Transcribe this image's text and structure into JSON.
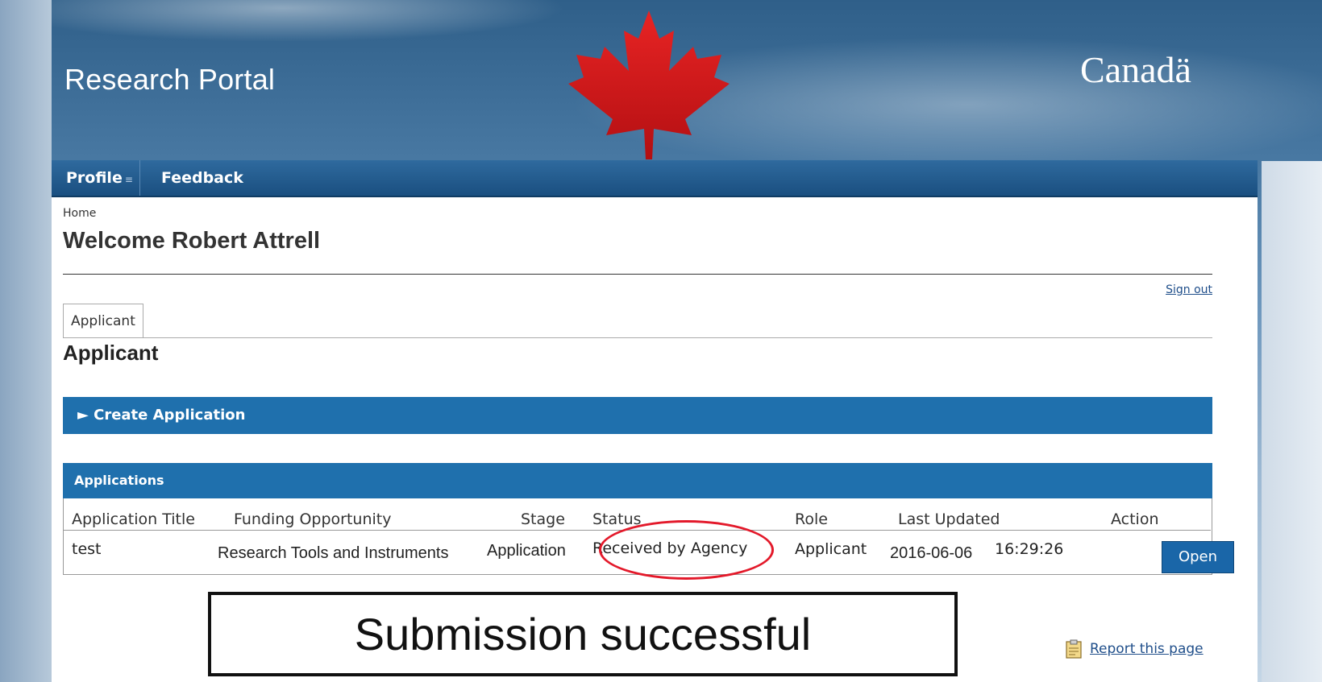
{
  "header": {
    "portal_title": "Research Portal",
    "wordmark": "Canadä"
  },
  "nav": {
    "items": [
      {
        "label": "Profile",
        "has_dropdown": true
      },
      {
        "label": "Feedback"
      }
    ]
  },
  "breadcrumb": "Home",
  "page_title": "Welcome Robert Attrell",
  "sign_out": "Sign out",
  "tabs": [
    {
      "label": "Applicant",
      "active": true
    }
  ],
  "section_heading": "Applicant",
  "create_application": "► Create Application",
  "applications": {
    "header": "Applications",
    "columns": [
      "Application Title",
      "Funding Opportunity",
      "Stage",
      "Status",
      "Role",
      "Last Updated",
      "Action"
    ],
    "rows": [
      {
        "title": "test",
        "funding_opportunity": "Research Tools and Instruments",
        "stage": "Application",
        "status": "Received by Agency",
        "role": "Applicant",
        "last_updated_date": "2016-06-06",
        "last_updated_time": "16:29:26",
        "action": "Open"
      }
    ]
  },
  "callout": "Submission successful",
  "report_link": "Report this page",
  "colors": {
    "nav_bar": "#1a4f80",
    "section_bar": "#1f70ad",
    "highlight_circle": "#e3192a",
    "link": "#1f4e8a",
    "leaf_red": "#d51a1a"
  }
}
